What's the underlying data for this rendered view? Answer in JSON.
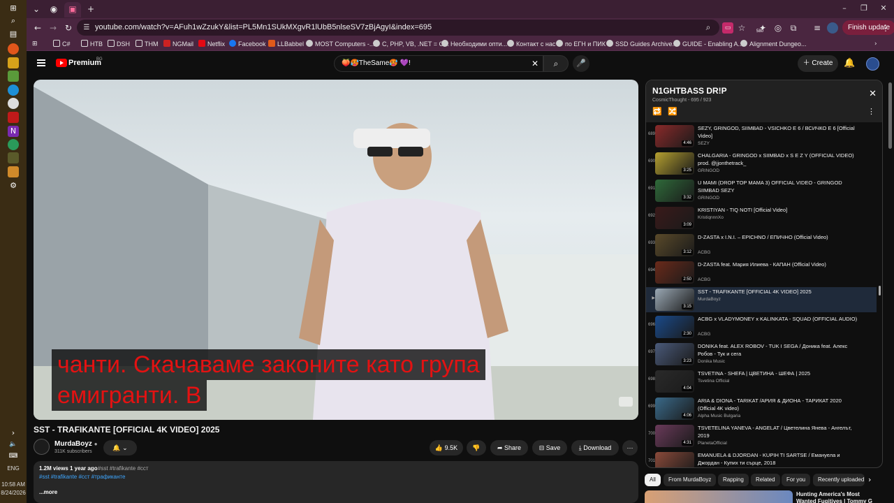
{
  "taskbar": {
    "lang": "ENG",
    "time": "10:58 AM",
    "date": "8/24/2026"
  },
  "browser": {
    "url": "youtube.com/watch?v=AFuh1wZzukY&list=PL5Mn1SUkMXgvR1lUbB5nlseSV7zBjAgyI&index=695",
    "finish_update": "Finish update",
    "badge": "580",
    "bookmarks": [
      "C#",
      "HTB",
      "DSH",
      "THM",
      "NGMail",
      "Netflix",
      "Facebook",
      "LLBabbel",
      "MOST Computers -...",
      "C, PHP, VB, .NET = O...",
      "Необходими опти...",
      "Контакт с нас",
      "по ЕГН и ПИК",
      "SSD Guides Archive...",
      "GUIDE - Enabling A...",
      "Alignment Dungeo..."
    ]
  },
  "header": {
    "brand": "Premium",
    "country": "BG",
    "search_value": "🍑🥵TheSame🥵 💜!",
    "create": "Create"
  },
  "player": {
    "caption_line1": "чанти. Скачаваме законите като група",
    "caption_line2": "емигранти. В"
  },
  "video": {
    "title": "SST - TRAFIKANTE [OFFICIAL 4K VIDEO] 2025",
    "channel": "MurdaBoyz",
    "subscribers": "311K subscribers",
    "likes": "9.5K",
    "share": "Share",
    "save": "Save",
    "download": "Download",
    "views": "1.2M views",
    "age": "1 year ago",
    "hashtags_top": "#sst #trafikante #сст",
    "hashtags_links": "#sst #trafikante #сст #трафиканте",
    "more": "...more"
  },
  "playlist": {
    "title": "N1GHTBASS DR!P",
    "subtitle": "CosmicThought - 695 / 923",
    "items": [
      {
        "index": "689",
        "title": "SEZY, GRINGOD, SIIMBAD - VSICHKO E 6 / ВСИЧКО Е 6 [Official Video]",
        "channel": "SEZY",
        "duration": "4:46",
        "thumb": "#8a2a2a"
      },
      {
        "index": "690",
        "title": "CHALGARIA - GRINGOD x SIIMBAD x S E Z Y (OFFICIAL VIDEO) prod. @jjonthetrack_",
        "channel": "GRINGOD",
        "duration": "3:25",
        "thumb": "#b5a030"
      },
      {
        "index": "691",
        "title": "U MAMI (DROP TOP MAMA 3) OFFICIAL VIDEO - GRINGOD SIIMBAD SEZY",
        "channel": "GRINGOD",
        "duration": "3:32",
        "thumb": "#2f6a3a"
      },
      {
        "index": "692",
        "title": "KRISTIYAN - TIQ NOTI [Official Video]",
        "channel": "KristiqnnnXo",
        "duration": "3:09",
        "thumb": "#3a1a1a"
      },
      {
        "index": "693",
        "title": "D-ZASTA x I.N.I. – EPICHNO / ЕПИЧНО (Official Video)",
        "channel": "ACBG",
        "duration": "3:12",
        "thumb": "#5a4a2a"
      },
      {
        "index": "694",
        "title": "D-ZASTA feat. Мария Илиева - КАПАН (Official Video)",
        "channel": "ACBG",
        "duration": "2:50",
        "thumb": "#6a2a1a"
      },
      {
        "index": "▶",
        "title": "SST - TRAFIKANTE [OFFICIAL 4K VIDEO] 2025",
        "channel": "MurdaBoyz",
        "duration": "3:15",
        "thumb": "#9aa8b4"
      },
      {
        "index": "696",
        "title": "ACBG x VLADYMONEY x KALINKATA - SQUAD (OFFICIAL AUDIO)",
        "channel": "ACBG",
        "duration": "2:30",
        "thumb": "#1a4a8a"
      },
      {
        "index": "697",
        "title": "DONIKA feat. ALEX ROBOV - TUK I SEGA / Доника feat. Алекс Робов - Тук и сега",
        "channel": "Donika Music",
        "duration": "3:23",
        "thumb": "#4a5a7a"
      },
      {
        "index": "698",
        "title": "TSVETINA - SHEFA | ЦВЕТИНА - ШЕФА | 2025",
        "channel": "Tsvetina Official",
        "duration": "4:04",
        "thumb": "#2a2a2a"
      },
      {
        "index": "699",
        "title": "ARIA & DIONA - TARIKAT /АРИЯ & ДИОНА - ТАРИКАТ 2020 (Official 4K video)",
        "channel": "Alpha Music Bulgaria",
        "duration": "4:06",
        "thumb": "#3a6a8a"
      },
      {
        "index": "700",
        "title": "TSVETELINA YANEVA - ANGELAT / Цветелина Янева - Ангелът, 2019",
        "channel": "PlanetaOfficial",
        "duration": "4:31",
        "thumb": "#6a3a5a"
      },
      {
        "index": "701",
        "title": "EMANUELA & DJORDAN - KUPIH TI SARTSE / Емануела и Джордан - Купих ти сърце, 2018",
        "channel": "PlanetaOfficial",
        "duration": "3:43",
        "thumb": "#8a4a3a"
      }
    ]
  },
  "chips": [
    "All",
    "From MurdaBoyz",
    "Rapping",
    "Related",
    "For you",
    "Recently uploaded"
  ],
  "recommendation": {
    "title": "Hunting America's Most Wanted Fugitives | Tommy G"
  }
}
